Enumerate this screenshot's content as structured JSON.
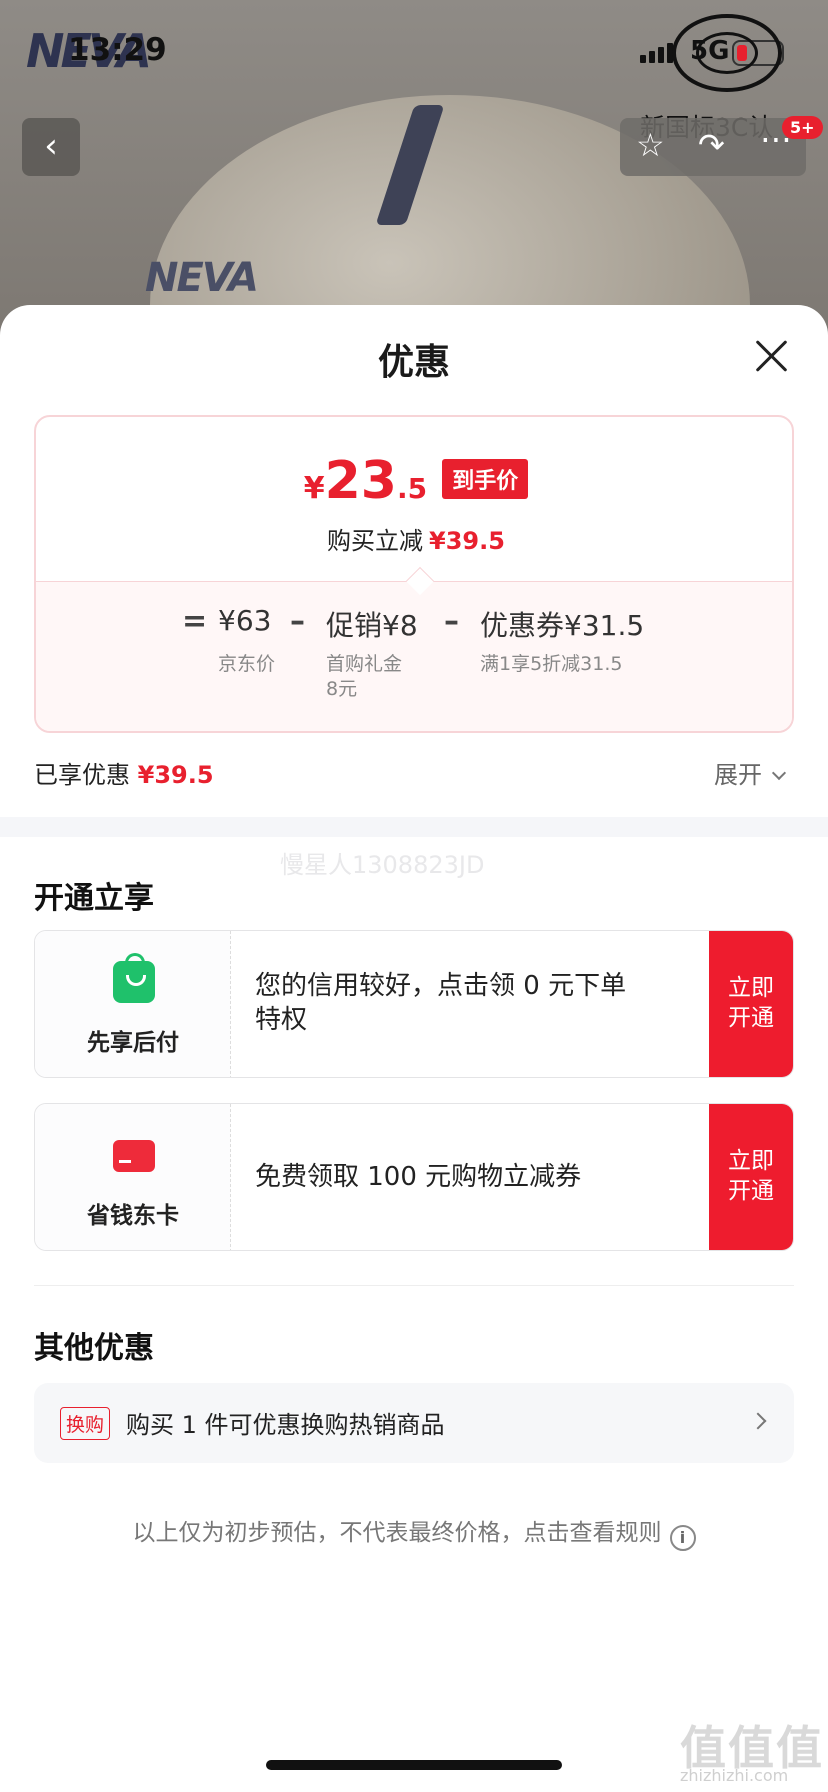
{
  "status_bar": {
    "time": "13:29",
    "network": "5G"
  },
  "background_page": {
    "brand": "NEVA",
    "helmet_logo": "NEVA",
    "cert_text": "新国标3C认",
    "badge": "5+"
  },
  "sheet": {
    "title": "优惠",
    "price": {
      "currency": "¥",
      "integer": "23",
      "decimal": ".5",
      "tag": "到手价"
    },
    "reduce": {
      "label": "购买立减",
      "amount": "¥39.5"
    },
    "calc": {
      "eq": "=",
      "minus": "–",
      "items": [
        {
          "value": "¥63",
          "sub": "京东价"
        },
        {
          "value": "促销¥8",
          "sub_line1": "首购礼金",
          "sub_line2": "8元"
        },
        {
          "value": "优惠券¥31.5",
          "sub": "满1享5折减31.5"
        }
      ]
    },
    "enjoyed": {
      "label": "已享优惠",
      "amount": "¥39.5"
    },
    "expand_label": "展开",
    "watermark": "慢星人1308823JD",
    "open_section": {
      "title": "开通立享",
      "cards": [
        {
          "name": "先享后付",
          "desc": "您的信用较好，点击领 0 元下单特权",
          "btn_line1": "立即",
          "btn_line2": "开通",
          "icon": "shopping-bag-icon"
        },
        {
          "name": "省钱东卡",
          "desc": "免费领取 100 元购物立减券",
          "btn_line1": "立即",
          "btn_line2": "开通",
          "icon": "card-icon"
        }
      ]
    },
    "other_section": {
      "title": "其他优惠",
      "swap_tag": "换购",
      "swap_text": "购买 1 件可优惠换购热销商品"
    },
    "disclaimer": "以上仅为初步预估，不代表最终价格，点击查看规则",
    "info_symbol": "i"
  },
  "site_watermark": {
    "mark": "值值值",
    "url": "zhizhizhi.com"
  },
  "colors": {
    "accent_red": "#e8202e",
    "green": "#1fc16b"
  }
}
